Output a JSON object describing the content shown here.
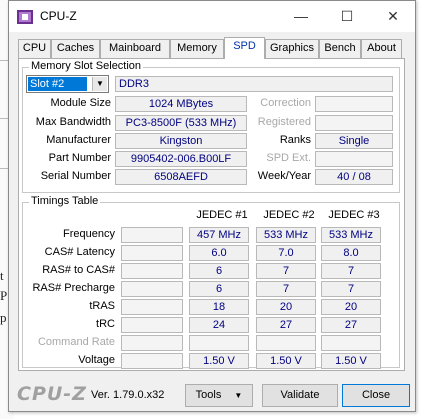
{
  "window": {
    "title": "CPU-Z",
    "minimize_glyph": "—",
    "maximize_glyph": "☐",
    "close_glyph": "✕",
    "icon": "cpu-z-app-icon"
  },
  "background": {
    "fragments": [
      "t",
      "P",
      "p"
    ]
  },
  "tabs": [
    {
      "label": "CPU",
      "active": false
    },
    {
      "label": "Caches",
      "active": false
    },
    {
      "label": "Mainboard",
      "active": false
    },
    {
      "label": "Memory",
      "active": false
    },
    {
      "label": "SPD",
      "active": true
    },
    {
      "label": "Graphics",
      "active": false
    },
    {
      "label": "Bench",
      "active": false
    },
    {
      "label": "About",
      "active": false
    }
  ],
  "memory_slot": {
    "group_title": "Memory Slot Selection",
    "slot_value": "Slot #2",
    "memory_type": "DDR3",
    "module_size_label": "Module Size",
    "module_size": "1024 MBytes",
    "max_bandwidth_label": "Max Bandwidth",
    "max_bandwidth": "PC3-8500F (533 MHz)",
    "manufacturer_label": "Manufacturer",
    "manufacturer": "Kingston",
    "part_number_label": "Part Number",
    "part_number": "9905402-006.B00LF",
    "serial_number_label": "Serial Number",
    "serial_number": "6508AEFD",
    "correction_label": "Correction",
    "correction": "",
    "registered_label": "Registered",
    "registered": "",
    "ranks_label": "Ranks",
    "ranks": "Single",
    "spd_ext_label": "SPD Ext.",
    "spd_ext": "",
    "week_year_label": "Week/Year",
    "week_year": "40 / 08"
  },
  "timings": {
    "group_title": "Timings Table",
    "columns": [
      "JEDEC #1",
      "JEDEC #2",
      "JEDEC #3"
    ],
    "rows": [
      {
        "label": "Frequency",
        "values": [
          "457 MHz",
          "533 MHz",
          "533 MHz"
        ],
        "dim": false
      },
      {
        "label": "CAS# Latency",
        "values": [
          "6.0",
          "7.0",
          "8.0"
        ],
        "dim": false
      },
      {
        "label": "RAS# to CAS#",
        "values": [
          "6",
          "7",
          "7"
        ],
        "dim": false
      },
      {
        "label": "RAS# Precharge",
        "values": [
          "6",
          "7",
          "7"
        ],
        "dim": false
      },
      {
        "label": "tRAS",
        "values": [
          "18",
          "20",
          "20"
        ],
        "dim": false
      },
      {
        "label": "tRC",
        "values": [
          "24",
          "27",
          "27"
        ],
        "dim": false
      },
      {
        "label": "Command Rate",
        "values": [
          "",
          "",
          ""
        ],
        "dim": true
      },
      {
        "label": "Voltage",
        "values": [
          "1.50 V",
          "1.50 V",
          "1.50 V"
        ],
        "dim": false
      }
    ]
  },
  "footer": {
    "logo": "CPU-Z",
    "version": "Ver. 1.79.0.x32",
    "tools_label": "Tools",
    "validate_label": "Validate",
    "close_label": "Close"
  }
}
